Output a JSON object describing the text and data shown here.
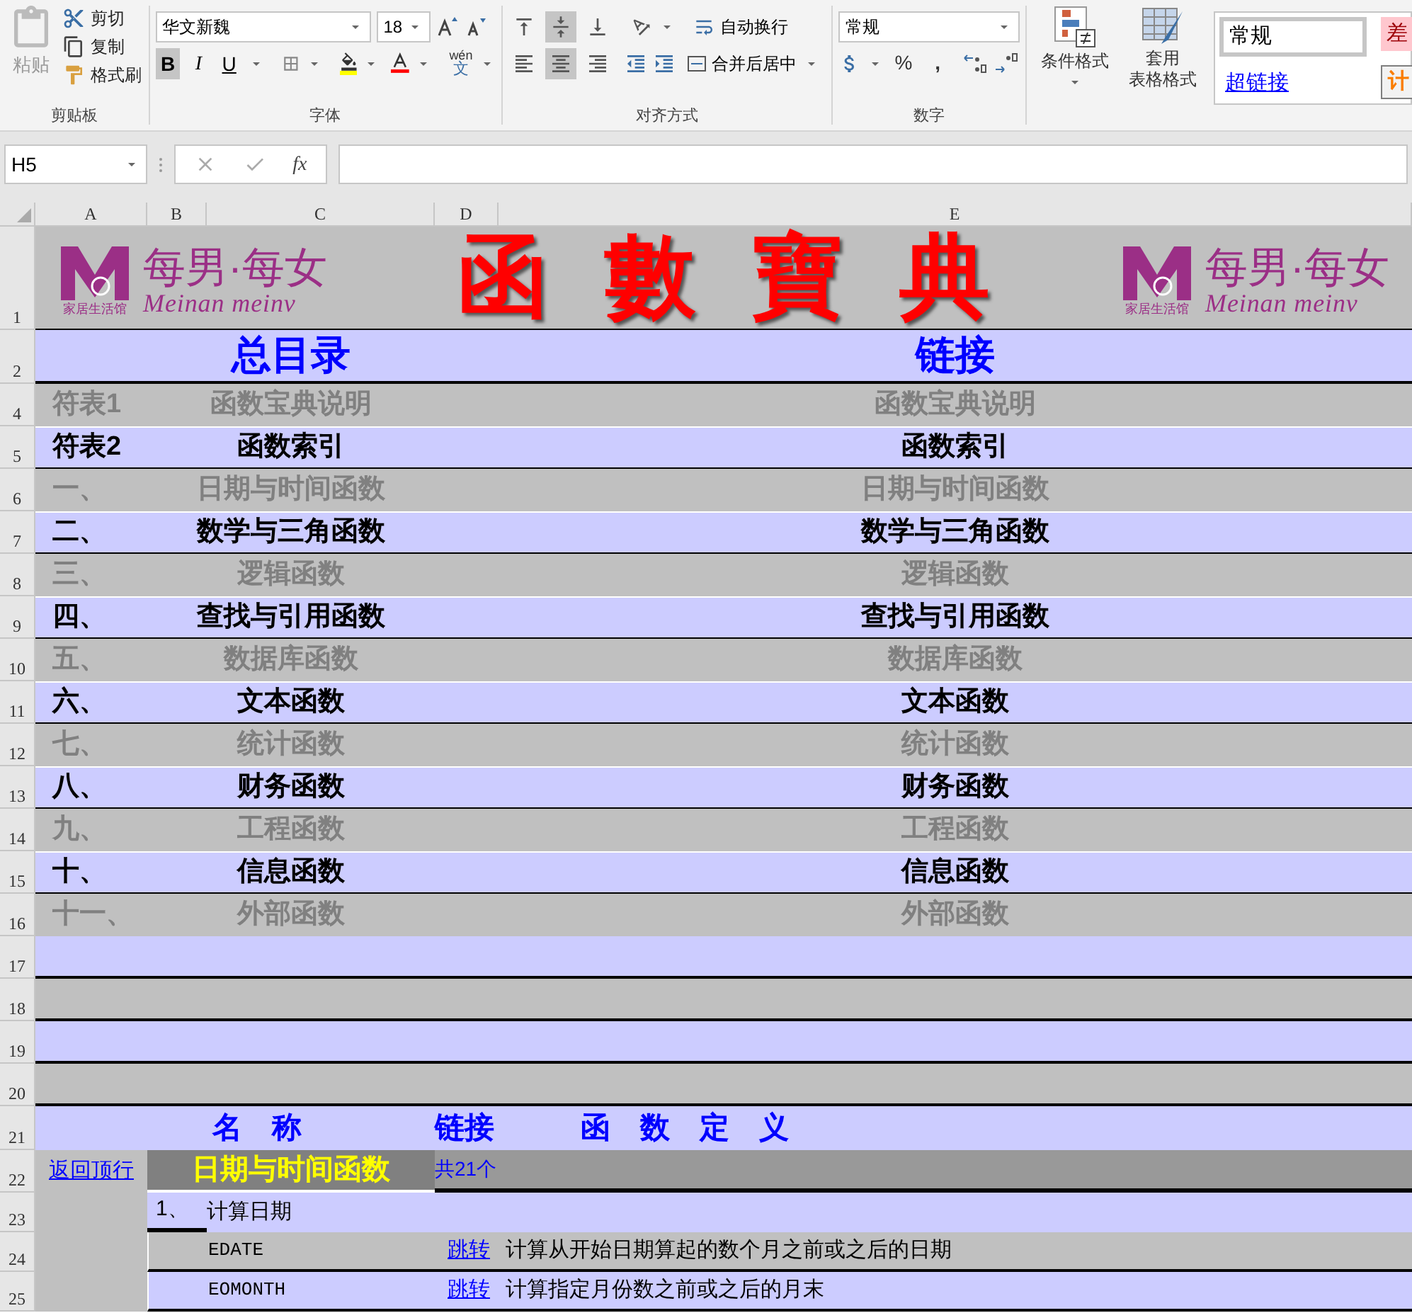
{
  "ribbon": {
    "clipboard": {
      "paste": "粘贴",
      "cut": "剪切",
      "copy": "复制",
      "format_painter": "格式刷",
      "label": "剪贴板"
    },
    "font": {
      "name": "华文新魏",
      "size": "18",
      "styles": [
        {
          "kind": "bold",
          "label": "B",
          "selected": true
        },
        {
          "kind": "italic",
          "label": "I",
          "selected": false
        },
        {
          "kind": "underline",
          "label": "U",
          "selected": false
        }
      ],
      "phonetic_top": "wén",
      "phonetic_char": "文",
      "label": "字体"
    },
    "alignment": {
      "vertical": [
        {
          "kind": "top",
          "selected": false
        },
        {
          "kind": "middle",
          "selected": true
        },
        {
          "kind": "bottom",
          "selected": false
        }
      ],
      "horizontal": [
        {
          "kind": "left",
          "selected": false
        },
        {
          "kind": "center",
          "selected": true
        },
        {
          "kind": "right",
          "selected": false
        }
      ],
      "wrap_text": "自动换行",
      "merge_center": "合并后居中",
      "label": "对齐方式"
    },
    "number": {
      "format": "常规",
      "percent": "%",
      "comma": ",",
      "label": "数字"
    },
    "styles": {
      "conditional_formatting": "条件格式",
      "format_as_table": [
        "套用",
        "表格格式"
      ],
      "cell_styles": [
        {
          "kind": "normal",
          "label": "常规"
        },
        {
          "kind": "bad",
          "label": "差"
        },
        {
          "kind": "hyperlink",
          "label": "超链接"
        },
        {
          "kind": "calculation",
          "label": "计"
        }
      ]
    }
  },
  "formula_bar": {
    "name_box": "H5",
    "function_label": "fx"
  },
  "sheet": {
    "columns": [
      "A",
      "B",
      "C",
      "D",
      "E"
    ],
    "banner": {
      "row": "1",
      "title": "函數寶典",
      "logos": [
        {
          "name": "每男·每女",
          "script": "Meinan meinv",
          "tag": "家居生活馆"
        },
        {
          "name": "每男·每女",
          "script": "Meinan meinv",
          "tag": "家居生活馆"
        }
      ]
    },
    "heading": {
      "row": "2",
      "title": "总目录",
      "link": "链接"
    },
    "index_rows": [
      {
        "row": "4",
        "number": "符表1",
        "name": "函数宝典说明",
        "link": "函数宝典说明",
        "color": "#c0c0c0",
        "dimmed": true
      },
      {
        "row": "5",
        "number": "符表2",
        "name": "函数索引",
        "link": "函数索引",
        "color": "#ccccff",
        "dimmed": false
      },
      {
        "row": "6",
        "number": "一、",
        "name": "日期与时间函数",
        "link": "日期与时间函数",
        "color": "#c0c0c0",
        "dimmed": true
      },
      {
        "row": "7",
        "number": "二、",
        "name": "数学与三角函数",
        "link": "数学与三角函数",
        "color": "#ccccff",
        "dimmed": false
      },
      {
        "row": "8",
        "number": "三、",
        "name": "逻辑函数",
        "link": "逻辑函数",
        "color": "#c0c0c0",
        "dimmed": true
      },
      {
        "row": "9",
        "number": "四、",
        "name": "查找与引用函数",
        "link": "查找与引用函数",
        "color": "#ccccff",
        "dimmed": false
      },
      {
        "row": "10",
        "number": "五、",
        "name": "数据库函数",
        "link": "数据库函数",
        "color": "#c0c0c0",
        "dimmed": true
      },
      {
        "row": "11",
        "number": "六、",
        "name": "文本函数",
        "link": "文本函数",
        "color": "#ccccff",
        "dimmed": false
      },
      {
        "row": "12",
        "number": "七、",
        "name": "统计函数",
        "link": "统计函数",
        "color": "#c0c0c0",
        "dimmed": true
      },
      {
        "row": "13",
        "number": "八、",
        "name": "财务函数",
        "link": "财务函数",
        "color": "#ccccff",
        "dimmed": false
      },
      {
        "row": "14",
        "number": "九、",
        "name": "工程函数",
        "link": "工程函数",
        "color": "#c0c0c0",
        "dimmed": true
      },
      {
        "row": "15",
        "number": "十、",
        "name": "信息函数",
        "link": "信息函数",
        "color": "#ccccff",
        "dimmed": false
      },
      {
        "row": "16",
        "number": "十一、",
        "name": "外部函数",
        "link": "外部函数",
        "color": "#c0c0c0",
        "dimmed": true
      }
    ],
    "empty_rows": [
      {
        "row": "17",
        "color": "#ccccff"
      },
      {
        "row": "18",
        "color": "#c0c0c0"
      },
      {
        "row": "19",
        "color": "#ccccff"
      },
      {
        "row": "20",
        "color": "#c0c0c0"
      }
    ],
    "section_header": {
      "row": "21",
      "name": "名　称",
      "link": "链接",
      "definition": "函　数　定　义"
    },
    "category": {
      "row": "22",
      "back_link": "返回顶行",
      "title": "日期与时间函数",
      "count": "共21个"
    },
    "group": {
      "row": "23",
      "number": "1、",
      "title": "计算日期"
    },
    "functions": [
      {
        "row": "24",
        "name": "EDATE",
        "link": "跳转",
        "description": "计算从开始日期算起的数个月之前或之后的日期",
        "color": "#c0c0c0"
      },
      {
        "row": "25",
        "name": "EOMONTH",
        "link": "跳转",
        "description": "计算指定月份数之前或之后的月末",
        "color": "#ccccff"
      }
    ]
  }
}
